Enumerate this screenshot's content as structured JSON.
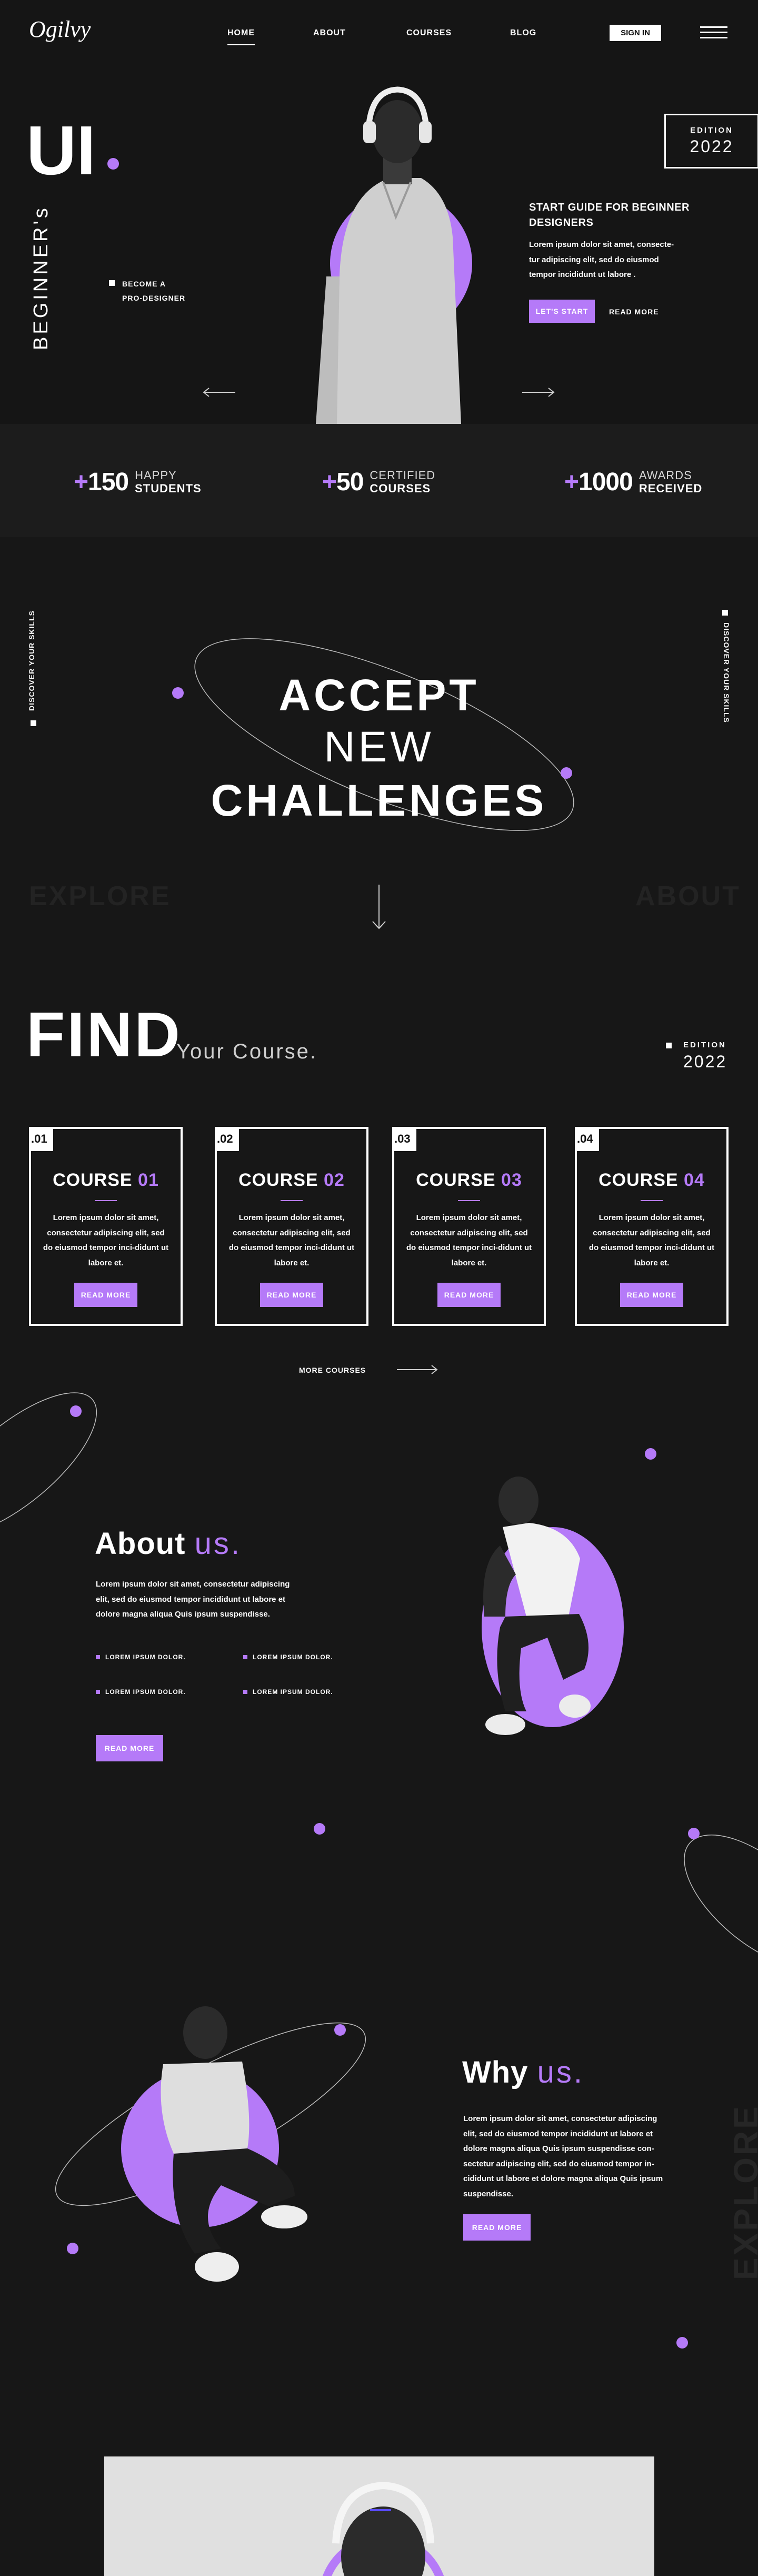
{
  "brand": {
    "logo": "Ogilvy"
  },
  "nav": {
    "items": [
      {
        "label": "HOME",
        "active": true
      },
      {
        "label": "ABOUT",
        "active": false
      },
      {
        "label": "COURSES",
        "active": false
      },
      {
        "label": "BLOG",
        "active": false
      }
    ],
    "signin": "SIGN IN"
  },
  "hero": {
    "big": "UI",
    "vertical": "BEGINNER's",
    "bullet_line1": "BECOME A",
    "bullet_line2": "PRO-DESIGNER",
    "edition_label": "EDITION",
    "edition_year": "2022",
    "title": "START GUIDE FOR BEGINNER DESIGNERS",
    "text": "Lorem ipsum dolor sit amet, consecte-tur adipiscing elit, sed do eiusmod tempor incididunt ut labore .",
    "cta_primary": "LET'S START",
    "cta_secondary": "READ MORE",
    "prev_icon": "arrow-left-icon",
    "next_icon": "arrow-right-icon"
  },
  "stats": [
    {
      "plus": "+",
      "value": "150",
      "line1": "HAPPY",
      "line2": "STUDENTS"
    },
    {
      "plus": "+",
      "value": "50",
      "line1": "CERTIFIED",
      "line2": "COURSES"
    },
    {
      "plus": "+",
      "value": "1000",
      "line1": "AWARDS",
      "line2": "RECEIVED"
    }
  ],
  "accept": {
    "line1": "ACCEPT",
    "line2": "NEW",
    "line3": "CHALLENGES",
    "side_left": "DISCOVER YOUR SKILLS",
    "side_right": "DISCOVER YOUR SKILLS",
    "ghost_left": "EXPLORE",
    "ghost_right": "ABOUT"
  },
  "find": {
    "title": "FIND",
    "subtitle": "Your Course.",
    "edition_label": "EDITION",
    "edition_year": "2022",
    "courses": [
      {
        "index": ".01",
        "name": "COURSE",
        "num": "01",
        "text": "Lorem ipsum dolor sit amet, consectetur adipiscing elit, sed do eiusmod tempor inci-didunt ut labore et.",
        "button": "READ MORE"
      },
      {
        "index": ".02",
        "name": "COURSE",
        "num": "02",
        "text": "Lorem ipsum dolor sit amet, consectetur adipiscing elit, sed do eiusmod tempor inci-didunt ut labore et.",
        "button": "READ MORE"
      },
      {
        "index": ".03",
        "name": "COURSE",
        "num": "03",
        "text": "Lorem ipsum dolor sit amet, consectetur adipiscing elit, sed do eiusmod tempor inci-didunt ut labore et.",
        "button": "READ MORE"
      },
      {
        "index": ".04",
        "name": "COURSE",
        "num": "04",
        "text": "Lorem ipsum dolor sit amet, consectetur adipiscing elit, sed do eiusmod tempor inci-didunt ut labore et.",
        "button": "READ MORE"
      }
    ],
    "more": "MORE COURSES"
  },
  "about": {
    "title": "About",
    "title_accent": "us.",
    "text": "Lorem ipsum dolor sit amet, consectetur adipiscing elit, sed do eiusmod tempor incididunt ut labore et dolore magna aliqua Quis ipsum suspendisse.",
    "bullets": [
      "LOREM IPSUM DOLOR.",
      "LOREM IPSUM DOLOR.",
      "LOREM IPSUM DOLOR.",
      "LOREM IPSUM DOLOR."
    ],
    "button": "READ MORE"
  },
  "why": {
    "title": "Why",
    "title_accent": "us.",
    "text": "Lorem ipsum dolor sit amet, consectetur adipiscing elit, sed do eiusmod tempor incididunt ut labore et dolore magna aliqua Quis ipsum suspendisse con-sectetur adipiscing elit, sed do eiusmod tempor in-cididunt ut labore et dolore magna aliqua Quis ipsum suspendisse.",
    "button": "READ MORE",
    "ghost": "EXPLORE"
  },
  "colors": {
    "accent": "#b57af8",
    "background": "#171717"
  }
}
